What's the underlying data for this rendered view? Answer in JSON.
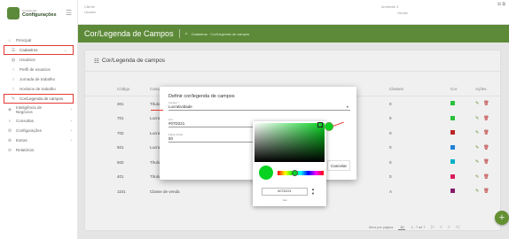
{
  "brand": {
    "subtitle": "Consultorias",
    "title": "Configurações"
  },
  "topbar": {
    "cliente": "Cliente",
    "usuario": "Usuario",
    "ambiente": "Ambiente 3",
    "versao": "Versão",
    "corner": "⊞ ⧉"
  },
  "sidebar": {
    "items": [
      {
        "label": "Principal",
        "icon": "home-icon",
        "glyph": "⌂"
      },
      {
        "label": "Cadastros",
        "icon": "list-icon",
        "glyph": "☰"
      },
      {
        "label": "Usuários",
        "icon": "users-icon",
        "glyph": "👥"
      },
      {
        "label": "Perfil de usuarios",
        "icon": "circle-icon",
        "glyph": "○"
      },
      {
        "label": "Jornada de trabalho",
        "icon": "circle-icon",
        "glyph": "○"
      },
      {
        "label": "Horários de trabalho",
        "icon": "circle-icon",
        "glyph": "○"
      },
      {
        "label": "Cor/Legenda de campos",
        "icon": "pencil-icon",
        "glyph": "✎"
      },
      {
        "label": "Inteligência de Negócios",
        "icon": "bulb-icon",
        "glyph": "◈"
      },
      {
        "label": "Consultas",
        "icon": "search-icon",
        "glyph": "⌕"
      },
      {
        "label": "Configurações",
        "icon": "gear-icon",
        "glyph": "⚙"
      },
      {
        "label": "Extras",
        "icon": "extras-icon",
        "glyph": "⊕"
      },
      {
        "label": "Relatórios",
        "icon": "report-icon",
        "glyph": "⊘"
      }
    ]
  },
  "banner": {
    "title": "Cor/Legenda de Campos",
    "crumb": "Cadastros · Cor/Legenda de campos"
  },
  "card": {
    "title": "Cor/Legenda de campos"
  },
  "table": {
    "headers": {
      "codigo": "Código",
      "categoria": "Campo",
      "classe": "Classes",
      "cor": "Cor",
      "acoes": "Ações"
    },
    "rows": [
      {
        "codigo": "301",
        "categoria": "Título",
        "classe": "0",
        "color": "#2ecc40"
      },
      {
        "codigo": "701",
        "categoria": "Lucrativ",
        "classe": "0",
        "color": "#2ecc40"
      },
      {
        "codigo": "702",
        "categoria": "Lucrativ",
        "classe": "0",
        "color": "#c62828"
      },
      {
        "codigo": "501",
        "categoria": "Lucrativ",
        "classe": "0",
        "color": "#1e88e5"
      },
      {
        "codigo": "502",
        "categoria": "Título",
        "classe": "0",
        "color": "#00bcd4"
      },
      {
        "codigo": "401",
        "categoria": "Título",
        "classe": "0",
        "color": "#e91e63"
      },
      {
        "codigo": "1101",
        "categoria": "Classe de venda",
        "classe": "A",
        "color": "#8e1e70"
      }
    ]
  },
  "pager": {
    "per_page_label": "Itens por página",
    "per_page": "10",
    "range": "1 - 7 de 7"
  },
  "dialog": {
    "title": "Definir cor/legenda de campos",
    "campo_label": "Campo *",
    "campo_value": "Lucratividade",
    "cor_label": "Cor",
    "cor_value": "#07D221",
    "faixa_label": "Faixa Inicial",
    "faixa_value": "50",
    "cancel": "Cancelar"
  },
  "picker": {
    "hex": "#07D221",
    "mode": "hex",
    "color": "#07D221"
  }
}
